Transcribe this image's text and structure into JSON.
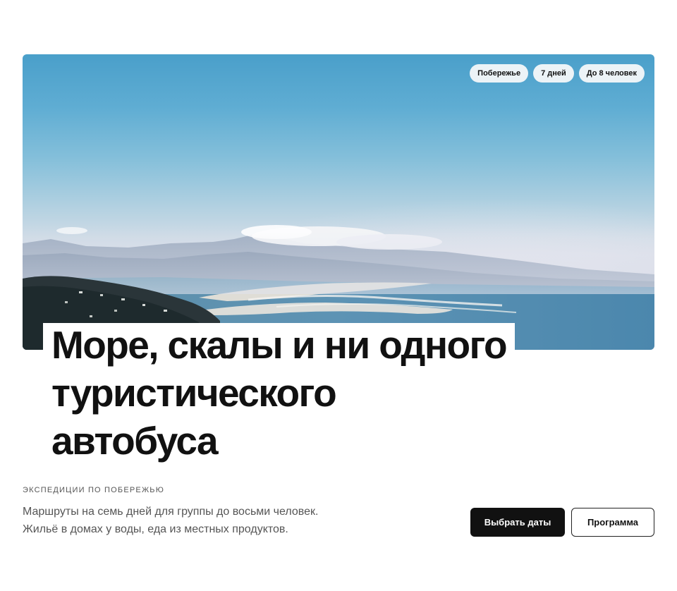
{
  "hero": {
    "image_alt_icon": "coastline-photo",
    "tags": [
      {
        "label": "Побережье"
      },
      {
        "label": "7 дней"
      },
      {
        "label": "До 8 человек"
      }
    ]
  },
  "title": {
    "lines": [
      "Море, скалы и ни одного",
      "туристического",
      "автобуса"
    ]
  },
  "eyebrow": "ЭКСПЕДИЦИИ ПО ПОБЕРЕЖЬЮ",
  "description": {
    "line1": "Маршруты на семь дней для группы до восьми человек.",
    "line2": "Жильё в домах у воды, еда из местных продуктов."
  },
  "actions": {
    "primary_label": "Выбрать даты",
    "secondary_label": "Программа"
  },
  "colors": {
    "primary_button": "#111111",
    "page_background": "#ffffff",
    "body_text": "#555555"
  }
}
